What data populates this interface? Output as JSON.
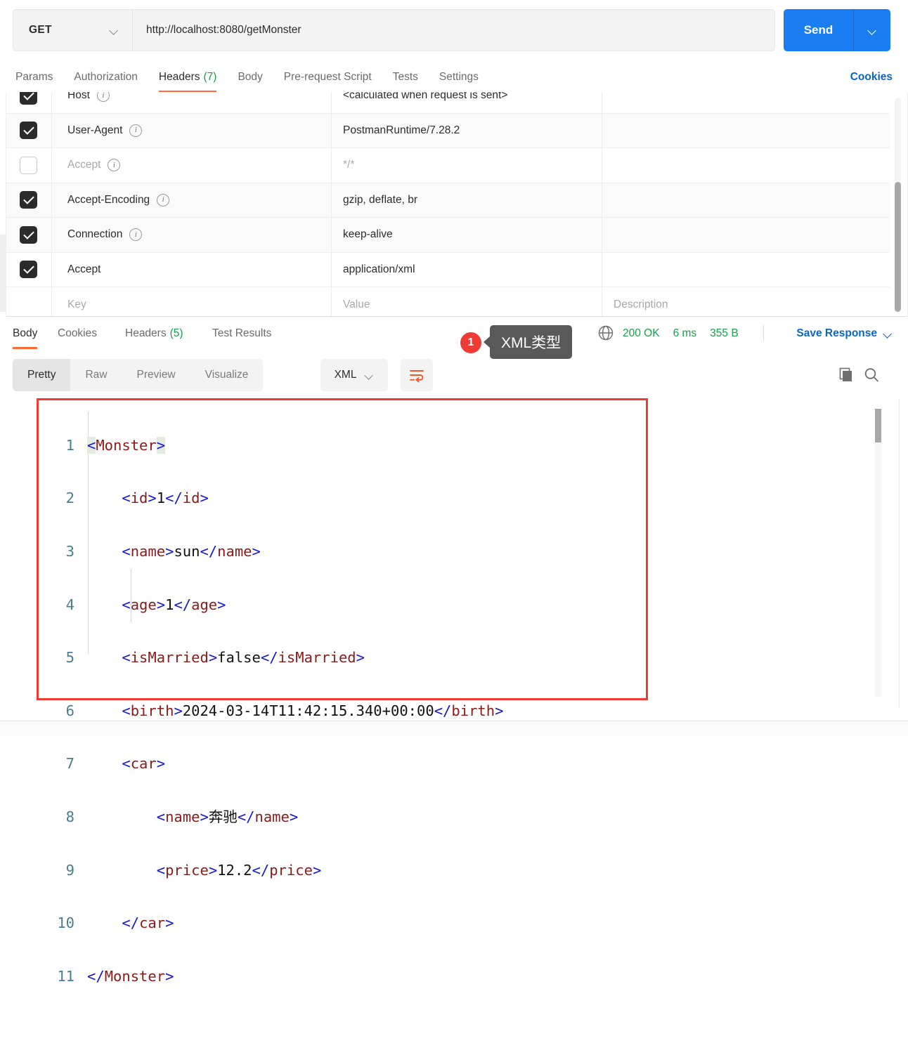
{
  "request": {
    "method": "GET",
    "url": "http://localhost:8080/getMonster",
    "send_label": "Send",
    "tabs": [
      {
        "label": "Params",
        "count": "",
        "active": false
      },
      {
        "label": "Authorization",
        "count": "",
        "active": false
      },
      {
        "label": "Headers",
        "count": "(7)",
        "active": true
      },
      {
        "label": "Body",
        "count": "",
        "active": false
      },
      {
        "label": "Pre-request Script",
        "count": "",
        "active": false
      },
      {
        "label": "Tests",
        "count": "",
        "active": false
      },
      {
        "label": "Settings",
        "count": "",
        "active": false
      }
    ],
    "cookies_link": "Cookies"
  },
  "headers_table": {
    "columns": [
      "Key",
      "Value",
      "Description"
    ],
    "rows": [
      {
        "checked": true,
        "key": "Host",
        "value": "<calculated when request is sent>",
        "description": "",
        "has_info": true,
        "disabled": false
      },
      {
        "checked": true,
        "key": "User-Agent",
        "value": "PostmanRuntime/7.28.2",
        "description": "",
        "has_info": true,
        "disabled": false
      },
      {
        "checked": false,
        "key": "Accept",
        "value": "*/*",
        "description": "",
        "has_info": true,
        "disabled": true
      },
      {
        "checked": true,
        "key": "Accept-Encoding",
        "value": "gzip, deflate, br",
        "description": "",
        "has_info": true,
        "disabled": false
      },
      {
        "checked": true,
        "key": "Connection",
        "value": "keep-alive",
        "description": "",
        "has_info": true,
        "disabled": false
      },
      {
        "checked": true,
        "key": "Accept",
        "value": "application/xml",
        "description": "",
        "has_info": false,
        "disabled": false
      }
    ],
    "placeholder_row": {
      "key": "Key",
      "value": "Value",
      "description": "Description"
    }
  },
  "response": {
    "tabs": [
      {
        "label": "Body",
        "count": "",
        "active": true
      },
      {
        "label": "Cookies",
        "count": "",
        "active": false
      },
      {
        "label": "Headers",
        "count": "(5)",
        "active": false
      },
      {
        "label": "Test Results",
        "count": "",
        "active": false
      }
    ],
    "annotation": {
      "badge": "1",
      "tooltip": "XML类型"
    },
    "status": "200 OK",
    "time": "6 ms",
    "size": "355 B",
    "save_response": "Save Response",
    "view_modes": [
      {
        "label": "Pretty",
        "active": true
      },
      {
        "label": "Raw",
        "active": false
      },
      {
        "label": "Preview",
        "active": false
      },
      {
        "label": "Visualize",
        "active": false
      }
    ],
    "format": "XML"
  },
  "body_code": {
    "language": "xml",
    "lines": [
      {
        "n": "1",
        "indent": 0,
        "content": "<Monster>"
      },
      {
        "n": "2",
        "indent": 1,
        "content": "<id>1</id>"
      },
      {
        "n": "3",
        "indent": 1,
        "content": "<name>sun</name>"
      },
      {
        "n": "4",
        "indent": 1,
        "content": "<age>1</age>"
      },
      {
        "n": "5",
        "indent": 1,
        "content": "<isMarried>false</isMarried>"
      },
      {
        "n": "6",
        "indent": 1,
        "content": "<birth>2024-03-14T11:42:15.340+00:00</birth>"
      },
      {
        "n": "7",
        "indent": 1,
        "content": "<car>"
      },
      {
        "n": "8",
        "indent": 2,
        "content": "<name>奔驰</name>"
      },
      {
        "n": "9",
        "indent": 2,
        "content": "<price>12.2</price>"
      },
      {
        "n": "10",
        "indent": 1,
        "content": "</car>"
      },
      {
        "n": "11",
        "indent": 0,
        "content": "</Monster>"
      }
    ]
  },
  "colors": {
    "accent_orange": "#ff6c37",
    "link_blue": "#0a66c2",
    "send_blue": "#1a7ef2",
    "status_green": "#1a9e4b",
    "annotation_red": "#ee3a32",
    "tag_maroon": "#8b1a1a",
    "bracket_blue": "#1515d6",
    "linenum_teal": "#4a7d8f"
  }
}
